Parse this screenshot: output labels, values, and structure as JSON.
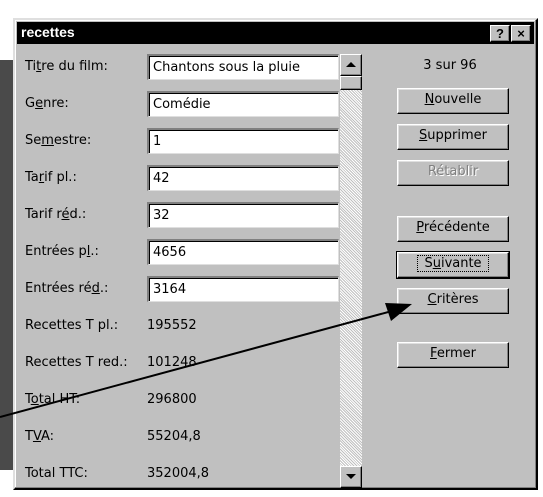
{
  "window": {
    "title": "recettes",
    "help_label": "?",
    "close_label": "×"
  },
  "fields": [
    {
      "label_pre": "Ti",
      "label_key": "t",
      "label_post": "re du film:",
      "value": "Chantons sous la pluie",
      "editable": true
    },
    {
      "label_pre": "G",
      "label_key": "e",
      "label_post": "nre:",
      "value": "Comédie",
      "editable": true
    },
    {
      "label_pre": "Se",
      "label_key": "m",
      "label_post": "estre:",
      "value": "1",
      "editable": true
    },
    {
      "label_pre": "Ta",
      "label_key": "r",
      "label_post": "if pl.:",
      "value": "42",
      "editable": true
    },
    {
      "label_pre": "Tarif r",
      "label_key": "é",
      "label_post": "d.:",
      "value": "32",
      "editable": true
    },
    {
      "label_pre": "Entrées p",
      "label_key": "l",
      "label_post": ".:",
      "value": "4656",
      "editable": true
    },
    {
      "label_pre": "Entrées ré",
      "label_key": "d",
      "label_post": ".:",
      "value": "3164",
      "editable": true
    },
    {
      "label_pre": "Recettes T pl.:",
      "label_key": "",
      "label_post": "",
      "value": "195552",
      "editable": false
    },
    {
      "label_pre": "Recettes T red.:",
      "label_key": "",
      "label_post": "",
      "value": "101248",
      "editable": false
    },
    {
      "label_pre": "T",
      "label_key": "o",
      "label_post": "tal HT:",
      "value": "296800",
      "editable": false
    },
    {
      "label_pre": "T",
      "label_key": "V",
      "label_post": "A:",
      "value": "55204,8",
      "editable": false
    },
    {
      "label_pre": "Total TTC:",
      "label_key": "",
      "label_post": "",
      "value": "352004,8",
      "editable": false
    }
  ],
  "record_count": "3 sur 96",
  "buttons": {
    "new": {
      "key": "N",
      "rest": "ouvelle"
    },
    "delete": {
      "key": "S",
      "rest": "upprimer"
    },
    "restore": {
      "label": "Rétablir"
    },
    "previous": {
      "key": "P",
      "rest": "récédente"
    },
    "next": {
      "pre": "S",
      "key": "u",
      "rest": "ivante"
    },
    "criteria": {
      "key": "C",
      "rest": "ritères"
    },
    "close": {
      "key": "F",
      "rest": "ermer"
    }
  },
  "colors": {
    "dialog_face": "#c0c0c0",
    "titlebar": "#000000",
    "background_shape": "#4a4a4a"
  },
  "icons": {
    "scroll_up": "triangle-up",
    "scroll_down": "triangle-down"
  }
}
